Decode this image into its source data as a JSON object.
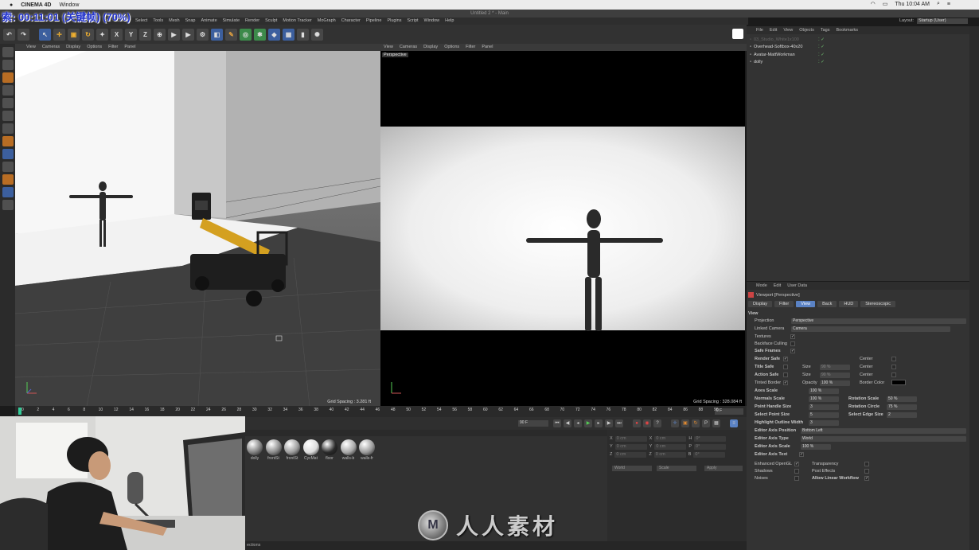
{
  "mac_menubar": {
    "app": "CINEMA 4D",
    "window": "Window",
    "clock": "Thu 10:04 AM"
  },
  "window_title": "Untitled 2 * - Main",
  "overlay_text": "索: 00:11:01 (关键帧) (70%)",
  "c4d_menu": [
    "Edit",
    "Create",
    "Select",
    "Tools",
    "Mesh",
    "Snap",
    "Animate",
    "Simulate",
    "Render",
    "Sculpt",
    "Motion Tracker",
    "MoGraph",
    "Character",
    "Pipeline",
    "Plugins",
    "Script",
    "Window",
    "Help"
  ],
  "layout_label": "Layout:",
  "layout_value": "Startup (User)",
  "toolbar_axes": [
    "X",
    "Y",
    "Z"
  ],
  "viewport_left": {
    "menu": [
      "View",
      "Cameras",
      "Display",
      "Options",
      "Filter",
      "Panel"
    ],
    "grid_spacing": "Grid Spacing : 3.281 ft"
  },
  "viewport_right": {
    "menu": [
      "View",
      "Cameras",
      "Display",
      "Options",
      "Filter",
      "Panel"
    ],
    "label": "Perspective",
    "grid_spacing": "Grid Spacing : 328.084 ft"
  },
  "timeline_ticks": [
    "0",
    "2",
    "4",
    "6",
    "8",
    "10",
    "12",
    "14",
    "16",
    "18",
    "20",
    "22",
    "24",
    "26",
    "28",
    "30",
    "32",
    "34",
    "36",
    "38",
    "40",
    "42",
    "44",
    "46",
    "48",
    "50",
    "52",
    "54",
    "56",
    "58",
    "60",
    "62",
    "64",
    "66",
    "68",
    "70",
    "72",
    "74",
    "76",
    "78",
    "80",
    "82",
    "84",
    "86",
    "88",
    "90"
  ],
  "timeline_frame": "0 F",
  "end_frame": "90 F",
  "materials": [
    {
      "label": "dolly",
      "color": "#808080"
    },
    {
      "label": "frontSt",
      "color": "#8a8a8a"
    },
    {
      "label": "frontSt",
      "color": "#9c9c9c"
    },
    {
      "label": "CycMat",
      "color": "#dcdcdc"
    },
    {
      "label": "floor",
      "color": "#2a2a2a"
    },
    {
      "label": "walls-b",
      "color": "#a8a8a8"
    },
    {
      "label": "walls-fr",
      "color": "#9a9a9a"
    }
  ],
  "coords": {
    "rows": [
      [
        "X",
        "0 cm",
        "X",
        "0 cm",
        "H",
        "0°"
      ],
      [
        "Y",
        "0 cm",
        "Y",
        "0 cm",
        "P",
        "0°"
      ],
      [
        "Z",
        "0 cm",
        "Z",
        "0 cm",
        "B",
        "0°"
      ]
    ],
    "world": "World",
    "scale": "Scale",
    "apply": "Apply"
  },
  "objects_menu": [
    "File",
    "Edit",
    "View",
    "Objects",
    "Tags",
    "Bookmarks"
  ],
  "objects": [
    {
      "name": "03_Studio_White1x100",
      "dim": true
    },
    {
      "name": "Overhead-Softbox-40x20",
      "dim": false
    },
    {
      "name": "Avatar-MattWorkman",
      "dim": false
    },
    {
      "name": "dolly",
      "dim": false
    }
  ],
  "attr_menu": [
    "Mode",
    "Edit",
    "User Data"
  ],
  "attr_title": "Viewport [Perspective]",
  "attr_tabs": [
    "Display",
    "Filter",
    "View",
    "Back",
    "HUD",
    "Stereoscopic"
  ],
  "attr_section": "View",
  "attr": {
    "projection_label": "Projection",
    "projection": "Perspective",
    "linked_camera_label": "Linked Camera",
    "linked_camera": "Camera",
    "textures": "Textures",
    "backface": "Backface Culling",
    "safe_frames": "Safe Frames",
    "render_safe": "Render Safe",
    "title_safe": "Title Safe",
    "action_safe": "Action Safe",
    "tinted_border": "Tinted Border",
    "size": "Size",
    "size_val": "90 %",
    "center": "Center",
    "opacity": "Opacity",
    "opacity_val": "100 %",
    "border_color": "Border Color",
    "axes_scale": "Axes Scale",
    "axes_scale_val": "100 %",
    "normals_scale": "Normals Scale",
    "normals_scale_val": "100 %",
    "rotation_scale": "Rotation Scale",
    "rotation_scale_val": "50 %",
    "point_handle": "Point Handle Size",
    "point_handle_val": "3",
    "rotation_circle": "Rotation Circle",
    "rotation_circle_val": "75 %",
    "select_point": "Select Point Size",
    "select_point_val": "5",
    "select_edge": "Select Edge Size",
    "select_edge_val": "2",
    "highlight": "Highlight Outline Width",
    "highlight_val": "3",
    "axis_pos": "Editor Axis Position",
    "axis_pos_val": "Bottom Left",
    "axis_type": "Editor Axis Type",
    "axis_type_val": "World",
    "axis_scale": "Editor Axis Scale",
    "axis_scale_val": "100 %",
    "axis_text": "Editor Axis Text",
    "enhanced": "Enhanced OpenGL",
    "transparency": "Transparency",
    "shadows": "Shadows",
    "post_effects": "Post Effects",
    "noises": "Noises",
    "linear": "Allow Linear Workflow"
  },
  "statusbar": "ections",
  "watermark_logo": "M",
  "watermark": "人人素材",
  "accent": "#5a82c4"
}
